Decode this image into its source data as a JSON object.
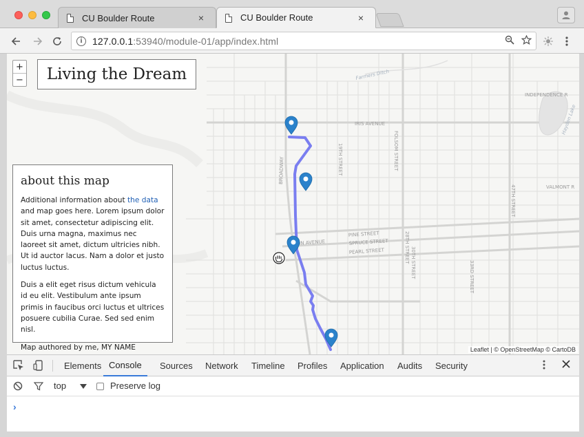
{
  "browser": {
    "tabs": [
      {
        "title": "CU Boulder Route",
        "close": "×"
      },
      {
        "title": "CU Boulder Route",
        "close": "×"
      }
    ],
    "url_host": "127.0.0.1",
    "url_rest": ":53940/module-01/app/index.html"
  },
  "map": {
    "title": "Living the Dream",
    "zoom_in": "+",
    "zoom_out": "−",
    "attribution": "Leaflet | © OpenStreetMap © CartoDB",
    "street_labels": [
      "Farmers Ditch",
      "IRIS AVENUE",
      "INDEPENDENCE R",
      "FOLSOM STREET",
      "19TH STREET",
      "BROADWAY",
      "VALMONT R",
      "PINE STREET",
      "SPRUCE STREET",
      "PEARL STREET",
      "28TH STREET",
      "30TH STREET",
      "33RD STREET",
      "47TH STREET",
      "ON AVENUE",
      "Hayden Lake"
    ]
  },
  "panel": {
    "heading": "about this map",
    "p1_pre": "Additional information about ",
    "p1_link": "the data",
    "p1_post": " and map goes here. Lorem ipsum dolor sit amet, consectetur adipiscing elit. Duis urna magna, maximus nec laoreet sit amet, dictum ultricies nibh. Ut id auctor lacus. Nam a dolor et justo luctus luctus.",
    "p2": "Duis a elit eget risus dictum vehicula id eu elit. Vestibulum ante ipsum primis in faucibus orci luctus et ultrices posuere cubilia Curae. Sed sed enim nisl.",
    "p3": "Map authored by me, MY NAME"
  },
  "devtools": {
    "tabs": [
      "Elements",
      "Console",
      "Sources",
      "Network",
      "Timeline",
      "Profiles",
      "Application",
      "Audits",
      "Security"
    ],
    "active_tab": "Console",
    "context": "top",
    "preserve_log": "Preserve log",
    "prompt": "›"
  },
  "colors": {
    "route": "#7a7ef0",
    "marker": "#2b82cb",
    "accent": "#3879d9"
  }
}
